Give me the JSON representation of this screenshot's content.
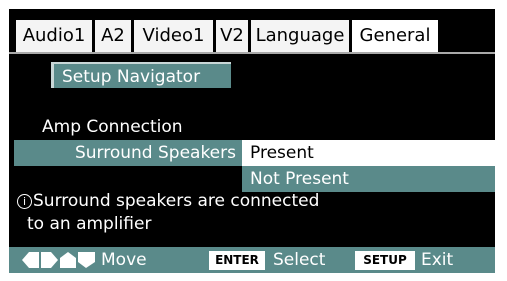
{
  "tabs": [
    {
      "label": "Audio1"
    },
    {
      "label": "A2"
    },
    {
      "label": "Video1"
    },
    {
      "label": "V2"
    },
    {
      "label": "Language"
    },
    {
      "label": "General",
      "active": true
    }
  ],
  "setup_navigator": "Setup Navigator",
  "amp_connection": "Amp Connection",
  "surround_speakers": {
    "label": "Surround Speakers",
    "options": [
      "Present",
      "Not Present"
    ],
    "selected": "Present"
  },
  "info": {
    "icon": "info-icon",
    "line1": "Surround speakers are connected",
    "line2": "to an amplifier"
  },
  "footer": {
    "move_label": "Move",
    "enter_key": "ENTER",
    "select_label": "Select",
    "setup_key": "SETUP",
    "exit_label": "Exit"
  },
  "colors": {
    "background": "#000000",
    "highlight": "#5a8a8a",
    "active_tab": "#ffffff"
  }
}
